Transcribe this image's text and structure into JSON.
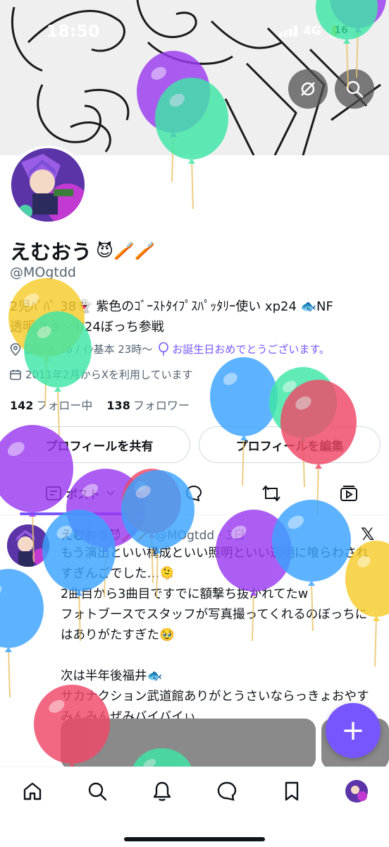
{
  "status_bar": {
    "time": "18:50",
    "network": "4G",
    "battery": "16"
  },
  "profile": {
    "display_name": "えむおう",
    "name_emojis": "😈🪥🪥",
    "handle": "@MOgtdd",
    "bio_line1": "2児ﾊﾟﾊﾟ 38👻 紫色のｺﾞｰｽﾄﾀｲﾌﾟｽﾊﾟｯﾀﾘｰ使い xp24 🐟NF",
    "bio_line2": "透明 3.9〜4/24ぼっち参戦",
    "location": "日曜休 16 / ｲﾝ基本 23時〜",
    "birthday": "お誕生日おめでとうございます。",
    "joined": "2011年2月からXを利用しています",
    "following_count": "142",
    "following_label": "フォロー中",
    "followers_count": "138",
    "followers_label": "フォロワー"
  },
  "buttons": {
    "share_profile": "プロフィールを共有",
    "edit_profile": "プロフィールを編集"
  },
  "tabs": {
    "posts": "ポスト"
  },
  "post": {
    "name": "えむおう😈🪥🪥",
    "handle_time": "@MOgtdd · 3日",
    "body": "もう演出といい構成といい照明といい透明に喰らわされすぎんごでした…🫠\n2曲目から3曲目ですでに額撃ち抜かれてたw\nフォトブースでスタッフが写真撮ってくれるのぼっちにはありがたすぎた🥹\n\n次は半年後福井🐟\nサカナクション武道館ありがとうさいならっきょおやすみんみんぜみバイバイぃ",
    "logo": "𝕏"
  },
  "fab": {
    "label": "+"
  },
  "colors": {
    "accent": "#7856ff",
    "text": "#0f1419",
    "muted": "#536471",
    "border": "#cfd9de"
  },
  "icons": [
    "location-pin-icon",
    "balloon-icon",
    "calendar-icon",
    "incognito-icon",
    "search-icon",
    "home-icon",
    "bell-icon",
    "chat-icon",
    "bookmark-icon",
    "repost-icon",
    "video-icon"
  ]
}
